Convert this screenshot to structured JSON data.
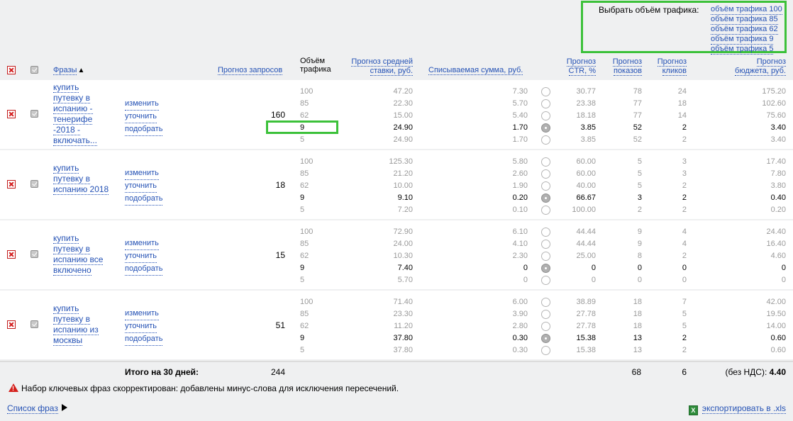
{
  "traffic_selector": {
    "label": "Выбрать объём трафика:",
    "options": [
      "объём трафика 100",
      "объём трафика 85",
      "объём трафика 62",
      "объём трафика 9",
      "объём трафика 5"
    ]
  },
  "header": {
    "phrases": "Фразы",
    "sort_arrow": "▲",
    "forecast_requests": "Прогноз запросов",
    "traffic_volume": [
      "Объём",
      "трафика"
    ],
    "avg_bid": [
      "Прогноз средней",
      "ставки, руб."
    ],
    "charged_sum": "Списываемая сумма, руб.",
    "ctr": [
      "Прогноз",
      "CTR, %"
    ],
    "impressions": [
      "Прогноз",
      "показов"
    ],
    "clicks": [
      "Прогноз",
      "кликов"
    ],
    "budget": [
      "Прогноз",
      "бюджета, руб."
    ]
  },
  "row_actions": [
    "изменить",
    "уточнить",
    "подобрать"
  ],
  "rows": [
    {
      "phrase": "купить путевку в испанию - тенерифе -2018 - включать...",
      "requests": "160",
      "sub": [
        {
          "traffic": "100",
          "bid": "47.20",
          "charged": "7.30",
          "ctr": "30.77",
          "impressions": "78",
          "clicks": "24",
          "budget": "175.20",
          "selected": false
        },
        {
          "traffic": "85",
          "bid": "22.30",
          "charged": "5.70",
          "ctr": "23.38",
          "impressions": "77",
          "clicks": "18",
          "budget": "102.60",
          "selected": false
        },
        {
          "traffic": "62",
          "bid": "15.00",
          "charged": "5.40",
          "ctr": "18.18",
          "impressions": "77",
          "clicks": "14",
          "budget": "75.60",
          "selected": false
        },
        {
          "traffic": "9",
          "bid": "24.90",
          "charged": "1.70",
          "ctr": "3.85",
          "impressions": "52",
          "clicks": "2",
          "budget": "3.40",
          "selected": true
        },
        {
          "traffic": "5",
          "bid": "24.90",
          "charged": "1.70",
          "ctr": "3.85",
          "impressions": "52",
          "clicks": "2",
          "budget": "3.40",
          "selected": false
        }
      ]
    },
    {
      "phrase": "купить путевку в испанию 2018",
      "requests": "18",
      "sub": [
        {
          "traffic": "100",
          "bid": "125.30",
          "charged": "5.80",
          "ctr": "60.00",
          "impressions": "5",
          "clicks": "3",
          "budget": "17.40",
          "selected": false
        },
        {
          "traffic": "85",
          "bid": "21.20",
          "charged": "2.60",
          "ctr": "60.00",
          "impressions": "5",
          "clicks": "3",
          "budget": "7.80",
          "selected": false
        },
        {
          "traffic": "62",
          "bid": "10.00",
          "charged": "1.90",
          "ctr": "40.00",
          "impressions": "5",
          "clicks": "2",
          "budget": "3.80",
          "selected": false
        },
        {
          "traffic": "9",
          "bid": "9.10",
          "charged": "0.20",
          "ctr": "66.67",
          "impressions": "3",
          "clicks": "2",
          "budget": "0.40",
          "selected": true
        },
        {
          "traffic": "5",
          "bid": "7.20",
          "charged": "0.10",
          "ctr": "100.00",
          "impressions": "2",
          "clicks": "2",
          "budget": "0.20",
          "selected": false
        }
      ]
    },
    {
      "phrase": "купить путевку в испанию все включено",
      "requests": "15",
      "sub": [
        {
          "traffic": "100",
          "bid": "72.90",
          "charged": "6.10",
          "ctr": "44.44",
          "impressions": "9",
          "clicks": "4",
          "budget": "24.40",
          "selected": false
        },
        {
          "traffic": "85",
          "bid": "24.00",
          "charged": "4.10",
          "ctr": "44.44",
          "impressions": "9",
          "clicks": "4",
          "budget": "16.40",
          "selected": false
        },
        {
          "traffic": "62",
          "bid": "10.30",
          "charged": "2.30",
          "ctr": "25.00",
          "impressions": "8",
          "clicks": "2",
          "budget": "4.60",
          "selected": false
        },
        {
          "traffic": "9",
          "bid": "7.40",
          "charged": "0",
          "ctr": "0",
          "impressions": "0",
          "clicks": "0",
          "budget": "0",
          "selected": true
        },
        {
          "traffic": "5",
          "bid": "5.70",
          "charged": "0",
          "ctr": "0",
          "impressions": "0",
          "clicks": "0",
          "budget": "0",
          "selected": false
        }
      ]
    },
    {
      "phrase": "купить путевку в испанию из москвы",
      "requests": "51",
      "sub": [
        {
          "traffic": "100",
          "bid": "71.40",
          "charged": "6.00",
          "ctr": "38.89",
          "impressions": "18",
          "clicks": "7",
          "budget": "42.00",
          "selected": false
        },
        {
          "traffic": "85",
          "bid": "23.30",
          "charged": "3.90",
          "ctr": "27.78",
          "impressions": "18",
          "clicks": "5",
          "budget": "19.50",
          "selected": false
        },
        {
          "traffic": "62",
          "bid": "11.20",
          "charged": "2.80",
          "ctr": "27.78",
          "impressions": "18",
          "clicks": "5",
          "budget": "14.00",
          "selected": false
        },
        {
          "traffic": "9",
          "bid": "37.80",
          "charged": "0.30",
          "ctr": "15.38",
          "impressions": "13",
          "clicks": "2",
          "budget": "0.60",
          "selected": true
        },
        {
          "traffic": "5",
          "bid": "37.80",
          "charged": "0.30",
          "ctr": "15.38",
          "impressions": "13",
          "clicks": "2",
          "budget": "0.60",
          "selected": false
        }
      ]
    }
  ],
  "total": {
    "label": "Итого на 30 дней:",
    "requests": "244",
    "impressions": "68",
    "clicks": "6",
    "budget_label": "(без НДС):",
    "budget": "4.40"
  },
  "warning": "Набор ключевых фраз скорректирован: добавлены минус-слова для исключения пересечений.",
  "footer": {
    "phrase_list": "Список фраз",
    "export": "экспортировать в .xls"
  },
  "colors": {
    "link": "#2552b5",
    "highlight": "#3cc13a",
    "delete": "#d21b1b",
    "dim_text": "#9a9a9a"
  }
}
